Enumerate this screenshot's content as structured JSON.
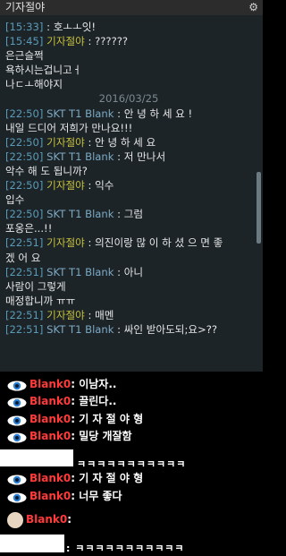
{
  "titlebar": {
    "title": "기자절야",
    "gear_icon": "gear-icon"
  },
  "chat": {
    "date": "2016/03/25",
    "lines": [
      {
        "time": "[15:33]",
        "name": "",
        "sep": " : ",
        "text": "호ㅗㅗ잇!"
      },
      {
        "time": "[15:45]",
        "name": "기자절야",
        "sep": " : ",
        "text": "??????"
      },
      {
        "cont": "은근슬쩍"
      },
      {
        "cont": "욕하시는겁니고ㅓ"
      },
      {
        "cont": "나ㄷㅗ해야지"
      },
      {
        "time": "[22:50]",
        "name": "SKT T1 Blank",
        "sep": " : ",
        "text": "안 녕 하 세 요 !"
      },
      {
        "cont": "내일 드디어 저희가 만나요!!!"
      },
      {
        "time": "[22:50]",
        "name": "기자절야",
        "sep": " : ",
        "text": "안 녕 하 세 요"
      },
      {
        "time": "[22:50]",
        "name": "SKT T1 Blank",
        "sep": " : ",
        "text": "저 만나서"
      },
      {
        "cont": "악수 해 도 됩니까?"
      },
      {
        "time": "[22:50]",
        "name": "기자절야",
        "sep": " : ",
        "text": "익수"
      },
      {
        "cont": "입수"
      },
      {
        "time": "[22:50]",
        "name": "SKT T1 Blank",
        "sep": " : ",
        "text": "그럼"
      },
      {
        "cont": "포옹은...!!"
      },
      {
        "time": "[22:51]",
        "name": "기자절야",
        "sep": " : ",
        "text": "의진이랑 많 이 하 셨 으 면 좋"
      },
      {
        "cont": "겠 어 요"
      },
      {
        "time": "[22:51]",
        "name": "SKT T1 Blank",
        "sep": " : ",
        "text": "아니"
      },
      {
        "cont": "사람이 그렇게"
      },
      {
        "cont": "매정합니까 ㅠㅠ"
      },
      {
        "time": "[22:51]",
        "name": "기자절야",
        "sep": " : ",
        "text": "매멘"
      },
      {
        "time": "[22:51]",
        "name": "SKT T1 Blank",
        "sep": " : ",
        "text": "싸인 받아도되;요>??"
      }
    ]
  },
  "overlay": {
    "name": "Blank0",
    "colon": ": ",
    "eye_icon": "eye-icon",
    "rows": [
      {
        "text": "이남자.."
      },
      {
        "text": "끌린다.."
      },
      {
        "text": "기 자 절 야 형"
      },
      {
        "text": "밀당 개잘함"
      },
      {
        "text": "기 자 절 야 형"
      },
      {
        "text": "너무 좋다"
      },
      {
        "text": ""
      }
    ],
    "laugh1": "ㅋㅋㅋㅋㅋㅋㅋㅋㅋㅋㅋ",
    "laugh2": ": ㅋㅋㅋㅋㅋㅋㅋㅋㅋㅋㅋ"
  }
}
